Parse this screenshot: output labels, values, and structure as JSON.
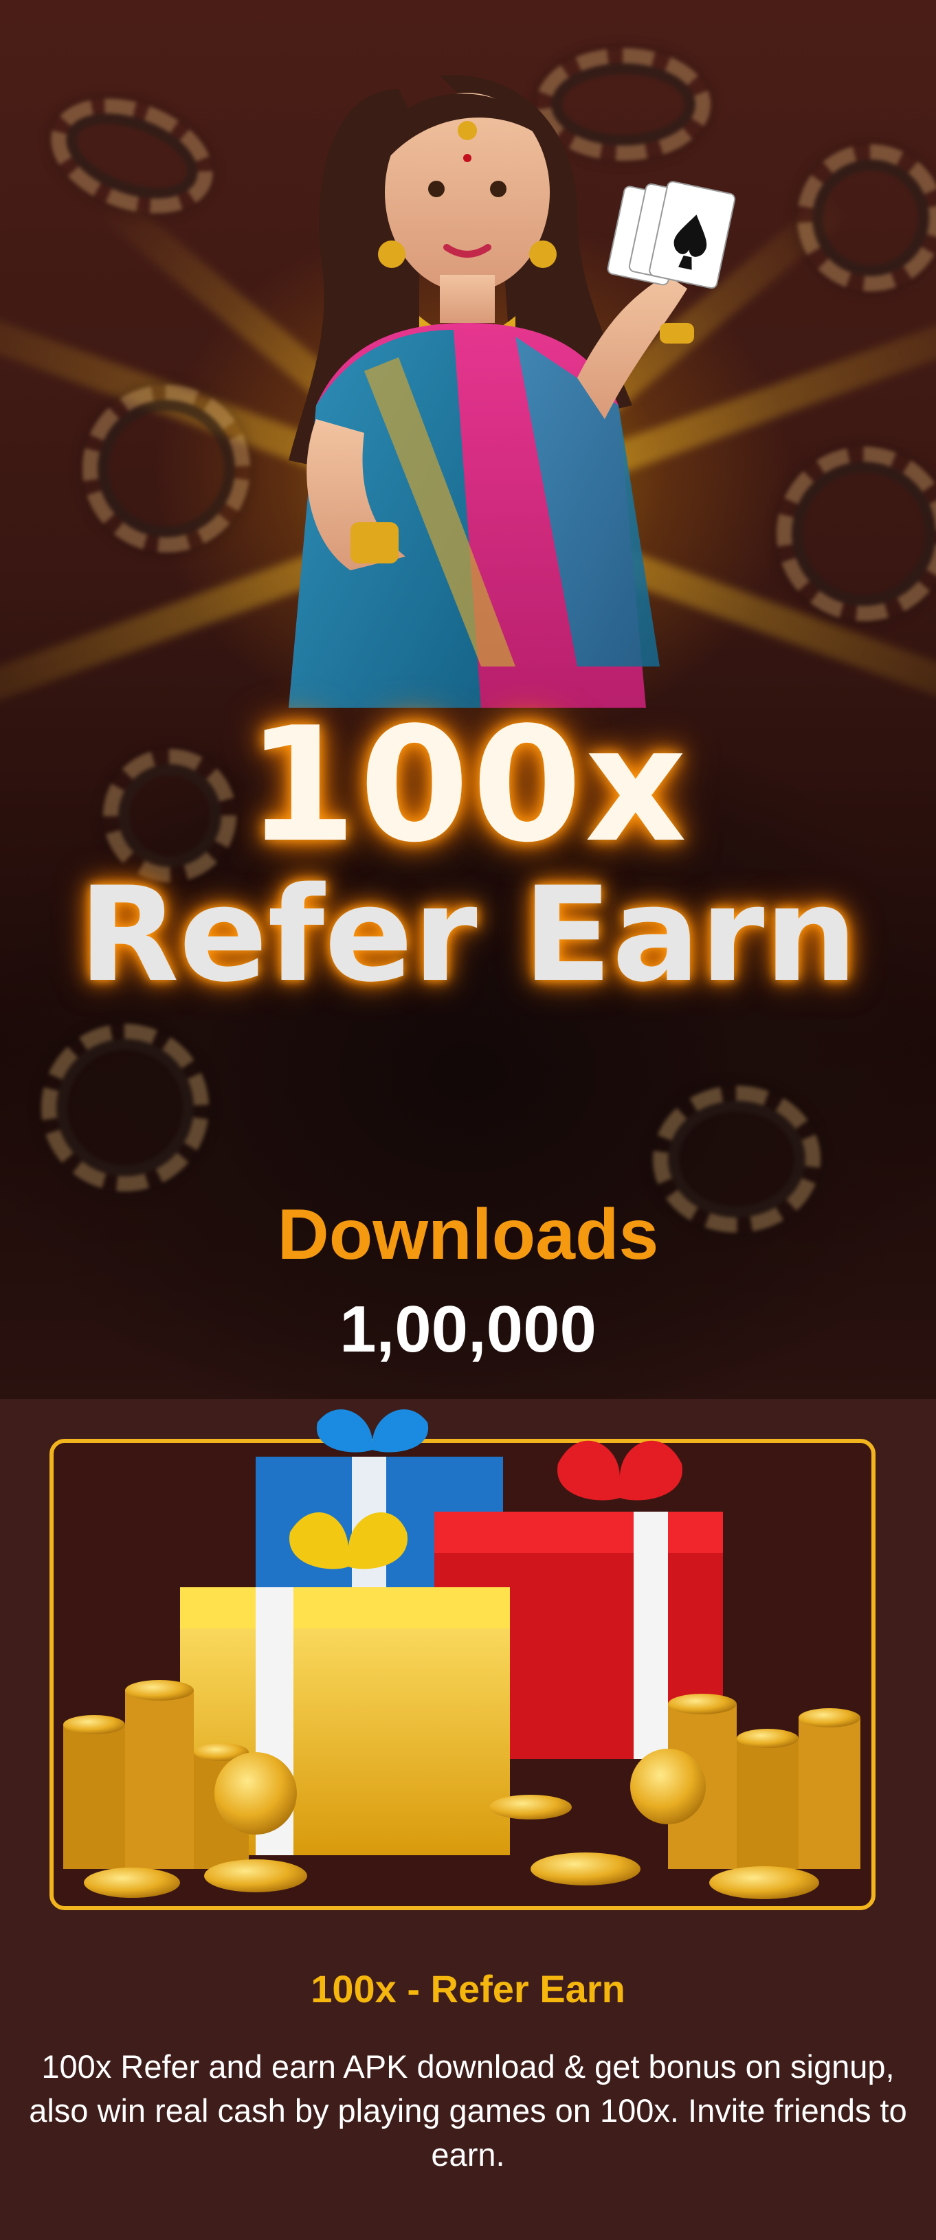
{
  "hero": {
    "headline_line1": "100x",
    "headline_line2": "Refer Earn"
  },
  "downloads": {
    "label": "Downloads",
    "count": "1,00,000"
  },
  "promo": {
    "title": "100x - Refer Earn",
    "description": "100x Refer and earn APK download & get bonus on signup, also win real cash by playing games on 100x. Invite friends to earn."
  },
  "colors": {
    "background": "#3f1d1b",
    "accent_orange": "#f59a10",
    "accent_gold": "#f5b70e",
    "card_border": "#f3b51d"
  },
  "icons": [
    "poker-chip-icon",
    "playing-cards-icon",
    "gift-box-icon",
    "gold-coin-icon"
  ]
}
